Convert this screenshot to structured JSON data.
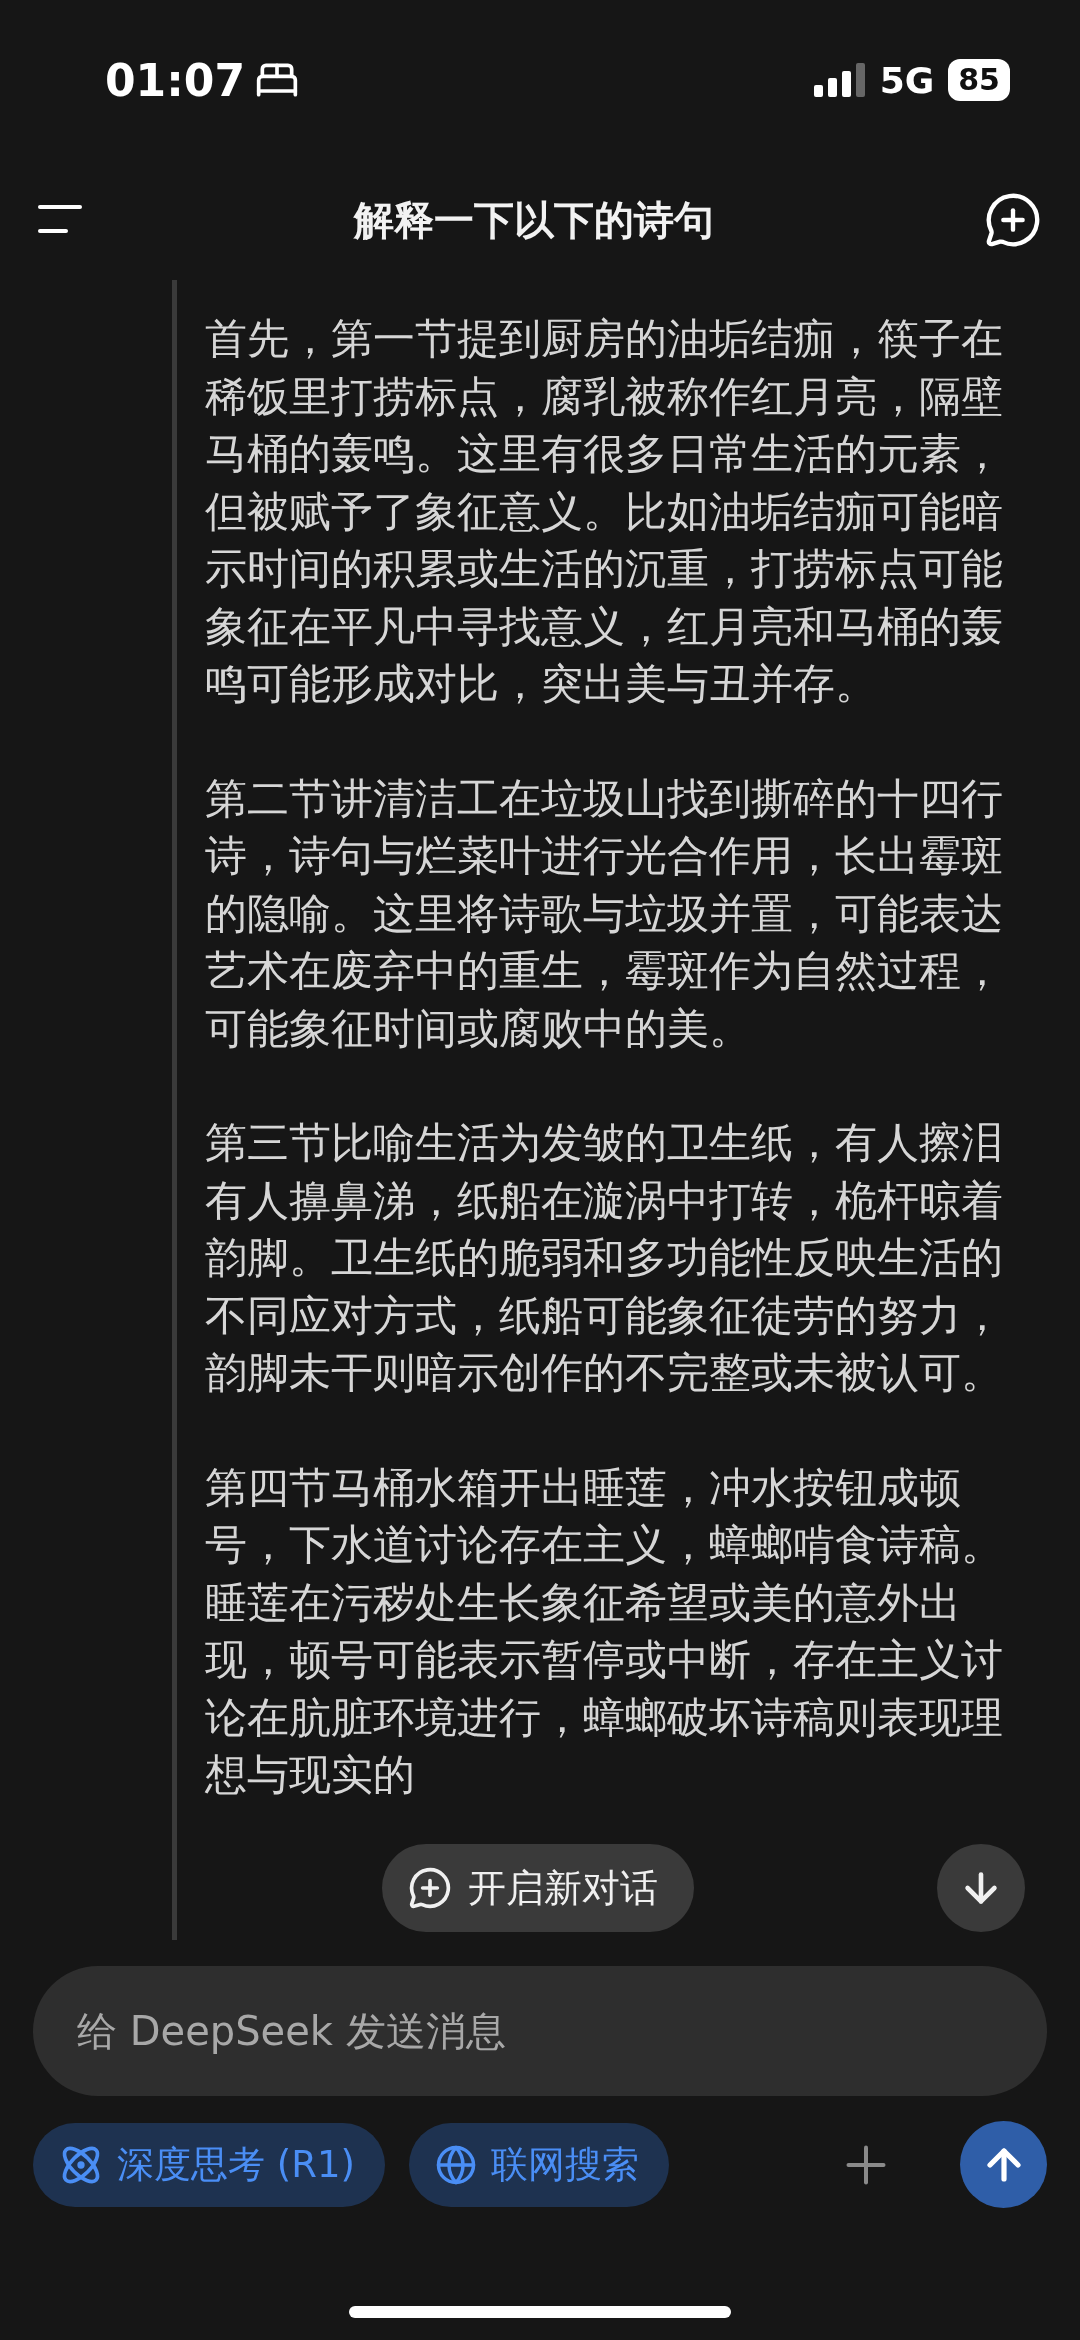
{
  "status_bar": {
    "time": "01:07",
    "network": "5G",
    "battery": "85"
  },
  "header": {
    "title": "解释一下以下的诗句"
  },
  "message": {
    "paragraphs": [
      "首先，第一节提到厨房的油垢结痂，筷子在稀饭里打捞标点，腐乳被称作红月亮，隔壁马桶的轰鸣。这里有很多日常生活的元素，但被赋予了象征意义。比如油垢结痂可能暗示时间的积累或生活的沉重，打捞标点可能象征在平凡中寻找意义，红月亮和马桶的轰鸣可能形成对比，突出美与丑并存。",
      "第二节讲清洁工在垃圾山找到撕碎的十四行诗，诗句与烂菜叶进行光合作用，长出霉斑的隐喻。这里将诗歌与垃圾并置，可能表达艺术在废弃中的重生，霉斑作为自然过程，可能象征时间或腐败中的美。",
      "第三节比喻生活为发皱的卫生纸，有人擦泪有人擤鼻涕，纸船在漩涡中打转，桅杆晾着韵脚。卫生纸的脆弱和多功能性反映生活的不同应对方式，纸船可能象征徒劳的努力，韵脚未干则暗示创作的不完整或未被认可。",
      "第四节马桶水箱开出睡莲，冲水按钮成顿号，下水道讨论存在主义，蟑螂啃食诗稿。睡莲在污秽处生长象征希望或美的意外出现，顿号可能表示暂停或中断，存在主义讨论在肮脏环境进行，蟑螂破坏诗稿则表现理想与现实的"
    ]
  },
  "new_chat_button": {
    "label": "开启新对话"
  },
  "composer": {
    "placeholder": "给 DeepSeek 发送消息",
    "toggles": [
      {
        "kind": "think",
        "label": "深度思考 (R1)",
        "selected": true
      },
      {
        "kind": "web",
        "label": "联网搜索",
        "selected": true
      }
    ]
  }
}
